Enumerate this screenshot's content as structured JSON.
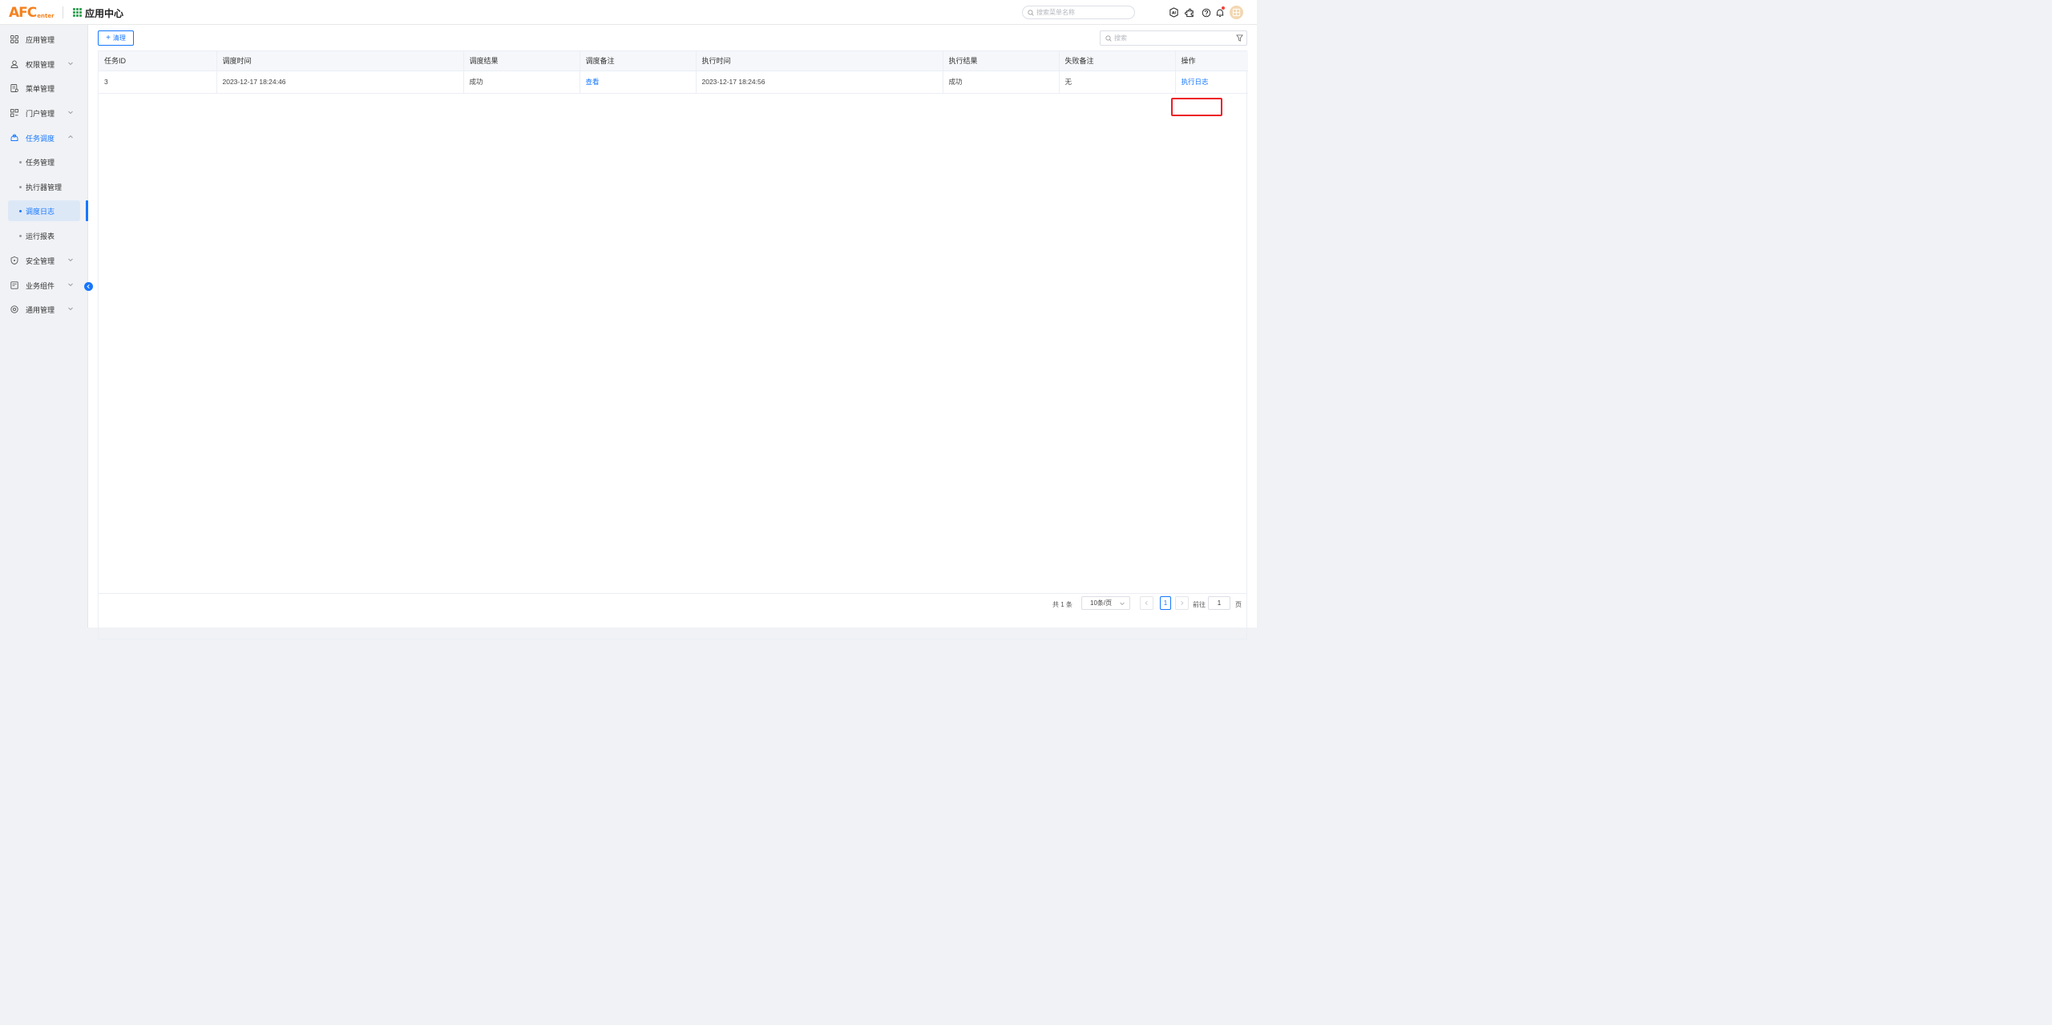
{
  "header": {
    "logo_main": "AFC",
    "logo_sub": "enter",
    "app_title": "应用中心",
    "menu_search_placeholder": "搜索菜单名称"
  },
  "sidebar": {
    "items": [
      {
        "label": "应用管理",
        "icon": "grid-icon"
      },
      {
        "label": "权限管理",
        "icon": "user-icon"
      },
      {
        "label": "菜单管理",
        "icon": "menu-doc-icon"
      },
      {
        "label": "门户管理",
        "icon": "portal-icon"
      },
      {
        "label": "任务调度",
        "icon": "schedule-icon"
      },
      {
        "label": "安全管理",
        "icon": "shield-icon"
      },
      {
        "label": "业务组件",
        "icon": "component-icon"
      },
      {
        "label": "通用管理",
        "icon": "settings-circle-icon"
      }
    ],
    "sub_items": [
      {
        "label": "任务管理"
      },
      {
        "label": "执行器管理"
      },
      {
        "label": "调度日志"
      },
      {
        "label": "运行报表"
      }
    ]
  },
  "toolbar": {
    "clean_label": "清理",
    "search_placeholder": "搜索"
  },
  "table": {
    "columns": [
      "任务ID",
      "调度时间",
      "调度结果",
      "调度备注",
      "执行时间",
      "执行结果",
      "失败备注",
      "操作"
    ],
    "rows": [
      {
        "task_id": "3",
        "schedule_time": "2023-12-17 18:24:46",
        "schedule_result": "成功",
        "schedule_remark": "查看",
        "exec_time": "2023-12-17 18:24:56",
        "exec_result": "成功",
        "fail_remark": "无",
        "action": "执行日志"
      }
    ]
  },
  "pagination": {
    "total": "共 1 条",
    "page_size": "10条/页",
    "current_page": "1",
    "goto_label": "前往",
    "goto_value": "1",
    "page_suffix": "页"
  },
  "colors": {
    "accent": "#1677ff",
    "logo": "#f5821f",
    "highlight_box": "#ee1c25"
  }
}
